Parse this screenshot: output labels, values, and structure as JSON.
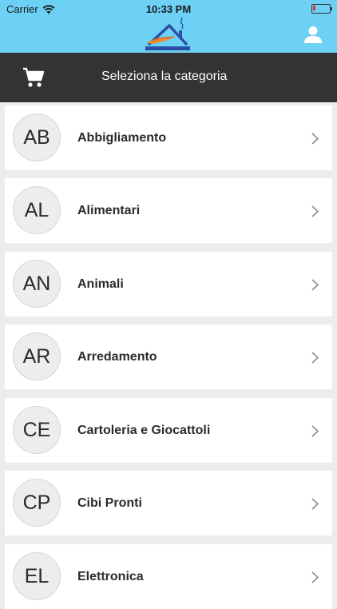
{
  "status_bar": {
    "carrier": "Carrier",
    "time": "10:33 PM",
    "battery_level": 0.15,
    "battery_color": "#e0312b"
  },
  "header": {
    "background": "#6dd0f5",
    "logo_icon": "house-logo-icon",
    "user_icon": "user-icon"
  },
  "toolbar": {
    "background": "#333333",
    "cart_icon": "cart-icon",
    "title": "Seleziona la categoria"
  },
  "categories": [
    {
      "badge": "AB",
      "label": "Abbigliamento"
    },
    {
      "badge": "AL",
      "label": "Alimentari"
    },
    {
      "badge": "AN",
      "label": "Animali"
    },
    {
      "badge": "AR",
      "label": "Arredamento"
    },
    {
      "badge": "CE",
      "label": "Cartoleria e Giocattoli"
    },
    {
      "badge": "CP",
      "label": "Cibi Pronti"
    },
    {
      "badge": "EL",
      "label": "Elettronica"
    }
  ]
}
